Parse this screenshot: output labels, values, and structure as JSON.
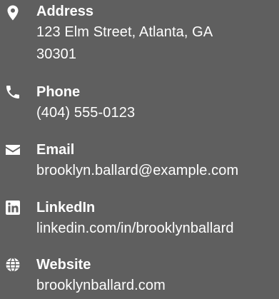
{
  "contact": {
    "items": [
      {
        "label": "Address",
        "value": "123 Elm Street, Atlanta, GA 30301",
        "icon": "map-pin-icon"
      },
      {
        "label": "Phone",
        "value": "(404) 555-0123",
        "icon": "phone-icon"
      },
      {
        "label": "Email",
        "value": "brooklyn.ballard@example.com",
        "icon": "envelope-icon"
      },
      {
        "label": "LinkedIn",
        "value": "linkedin.com/in/brooklynballard",
        "icon": "linkedin-icon"
      },
      {
        "label": "Website",
        "value": "brooklynballard.com",
        "icon": "globe-icon"
      }
    ]
  },
  "colors": {
    "background": "#5f5f5f",
    "text": "#ffffff"
  }
}
